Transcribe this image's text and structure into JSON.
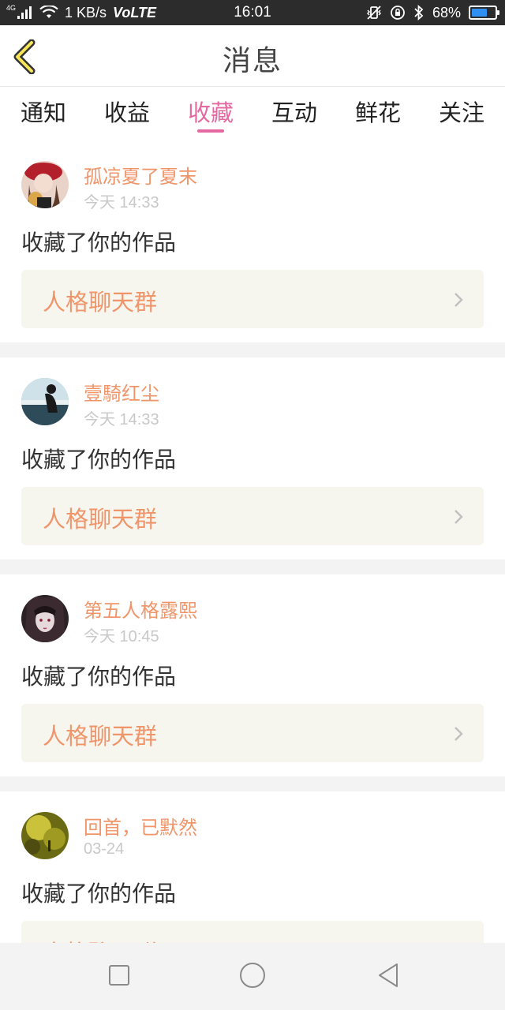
{
  "status_bar": {
    "network": "4G",
    "speed": "1 KB/s",
    "volte": "VoLTE",
    "time": "16:01",
    "battery_percent": "68%",
    "battery_level": 0.68
  },
  "header": {
    "back_icon": "chevron-left-icon",
    "title": "消息"
  },
  "tabs": [
    {
      "label": "通知",
      "active": false
    },
    {
      "label": "收益",
      "active": false
    },
    {
      "label": "收藏",
      "active": true
    },
    {
      "label": "互动",
      "active": false
    },
    {
      "label": "鲜花",
      "active": false
    },
    {
      "label": "关注",
      "active": false
    }
  ],
  "feed": [
    {
      "user": "孤凉夏了夏末",
      "time": "今天 14:33",
      "action": "收藏了你的作品",
      "work": "人格聊天群"
    },
    {
      "user": "壹騎红尘",
      "time": "今天 14:33",
      "action": "收藏了你的作品",
      "work": "人格聊天群"
    },
    {
      "user": "第五人格露熙",
      "time": "今天 10:45",
      "action": "收藏了你的作品",
      "work": "人格聊天群"
    },
    {
      "user": "回首，已默然",
      "time": "03-24",
      "action": "收藏了你的作品",
      "work": "人格聊天群"
    }
  ],
  "colors": {
    "accent_pink": "#e569a0",
    "accent_orange": "#f0956a",
    "work_box_bg": "#f6f5ee"
  },
  "nav": [
    "square-icon",
    "circle-icon",
    "triangle-back-icon"
  ]
}
